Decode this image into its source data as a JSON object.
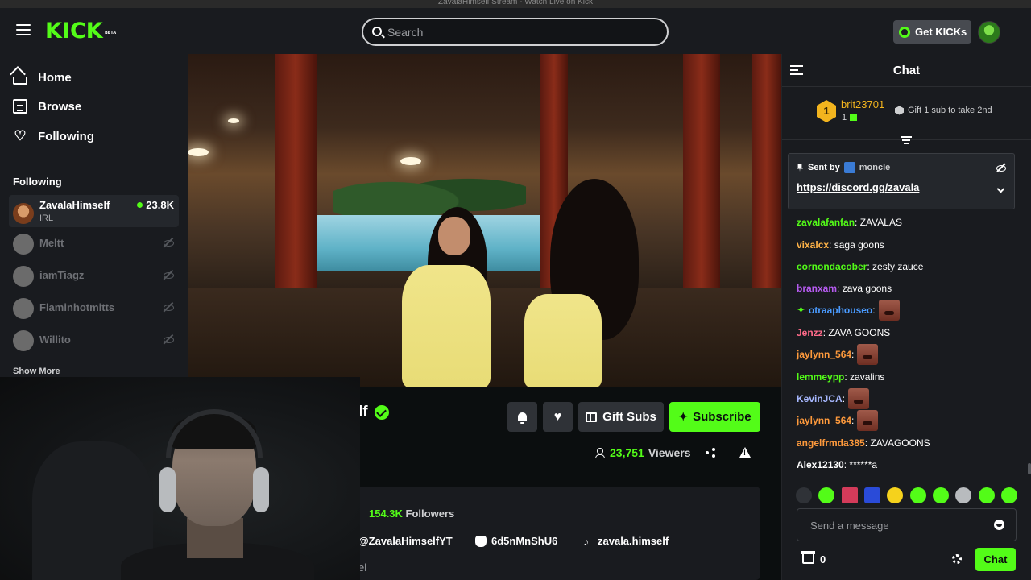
{
  "window": {
    "title": "ZavalaHimself Stream - Watch Live on Kick"
  },
  "header": {
    "logo": "KICK",
    "logo_badge": "BETA",
    "search_placeholder": "Search",
    "get_kicks_label": "Get KICKs"
  },
  "sidebar": {
    "nav": [
      {
        "label": "Home",
        "icon": "home-icon"
      },
      {
        "label": "Browse",
        "icon": "browse-icon"
      },
      {
        "label": "Following",
        "icon": "heart-icon"
      }
    ],
    "following_heading": "Following",
    "following": [
      {
        "name": "ZavalaHimself",
        "category": "IRL",
        "viewers": "23.8K",
        "live": true
      },
      {
        "name": "Meltt",
        "live": false
      },
      {
        "name": "iamTiagz",
        "live": false
      },
      {
        "name": "Flaminhotmitts",
        "live": false
      },
      {
        "name": "Willito",
        "live": false
      }
    ],
    "show_more_label": "Show More"
  },
  "channel": {
    "name_visible": "lf",
    "subtitle_visible": "l",
    "gift_subs_label": "Gift Subs",
    "subscribe_label": "Subscribe",
    "viewers_count": "23,751",
    "viewers_label": "Viewers",
    "followers_count": "154.3K",
    "followers_label": "Followers",
    "socials": [
      {
        "label": "@ZavalaHimselfYT",
        "icon": "youtube-icon"
      },
      {
        "label": "6d5nMnShU6",
        "icon": "discord-icon"
      },
      {
        "label": "zavala.himself",
        "icon": "tiktok-icon"
      }
    ],
    "about_cut_text": "el"
  },
  "chat": {
    "title": "Chat",
    "leaderboard": {
      "rank": "1",
      "user": "brit23701",
      "subs": "1",
      "gift_hint": "Gift 1 sub to take 2nd"
    },
    "pinned": {
      "sent_by_label": "Sent by",
      "moderator": "moncle",
      "link": "https://discord.gg/zavala"
    },
    "messages": [
      {
        "user": "zavalafanfan",
        "color": "#53fc18",
        "text": " ZAVALAS"
      },
      {
        "user": "vixalcx",
        "color": "#ffb347",
        "text": " saga goons"
      },
      {
        "user": "cornondacober",
        "color": "#53fc18",
        "text": " zesty zauce"
      },
      {
        "user": "branxam",
        "color": "#b65bf0",
        "text": " zava goons"
      },
      {
        "user": "otraaphouseo",
        "color": "#4a9bff",
        "text": "",
        "emote": true,
        "sparkle": true
      },
      {
        "user": "Jenzz",
        "color": "#ff6b8a",
        "text": " ZAVA GOONS"
      },
      {
        "user": "jaylynn_564",
        "color": "#ff9a3c",
        "text": "",
        "emote": true
      },
      {
        "user": "lemmeypp",
        "color": "#53fc18",
        "text": " zavalins"
      },
      {
        "user": "KevinJCA",
        "color": "#a7b8ff",
        "text": "",
        "emote": true
      },
      {
        "user": "jaylynn_564",
        "color": "#ff9a3c",
        "text": "",
        "emote": true
      },
      {
        "user": "angelfrmda385",
        "color": "#ff9a3c",
        "text": " ZAVAGOONS"
      },
      {
        "user": "Alex12130",
        "color": "#ffffff",
        "text": " ******a"
      }
    ],
    "input_placeholder": "Send a message",
    "kicks_balance": "0",
    "send_label": "Chat"
  },
  "colors": {
    "brand": "#53fc18",
    "bg": "#0b0e0f",
    "panel": "#191b1f"
  }
}
